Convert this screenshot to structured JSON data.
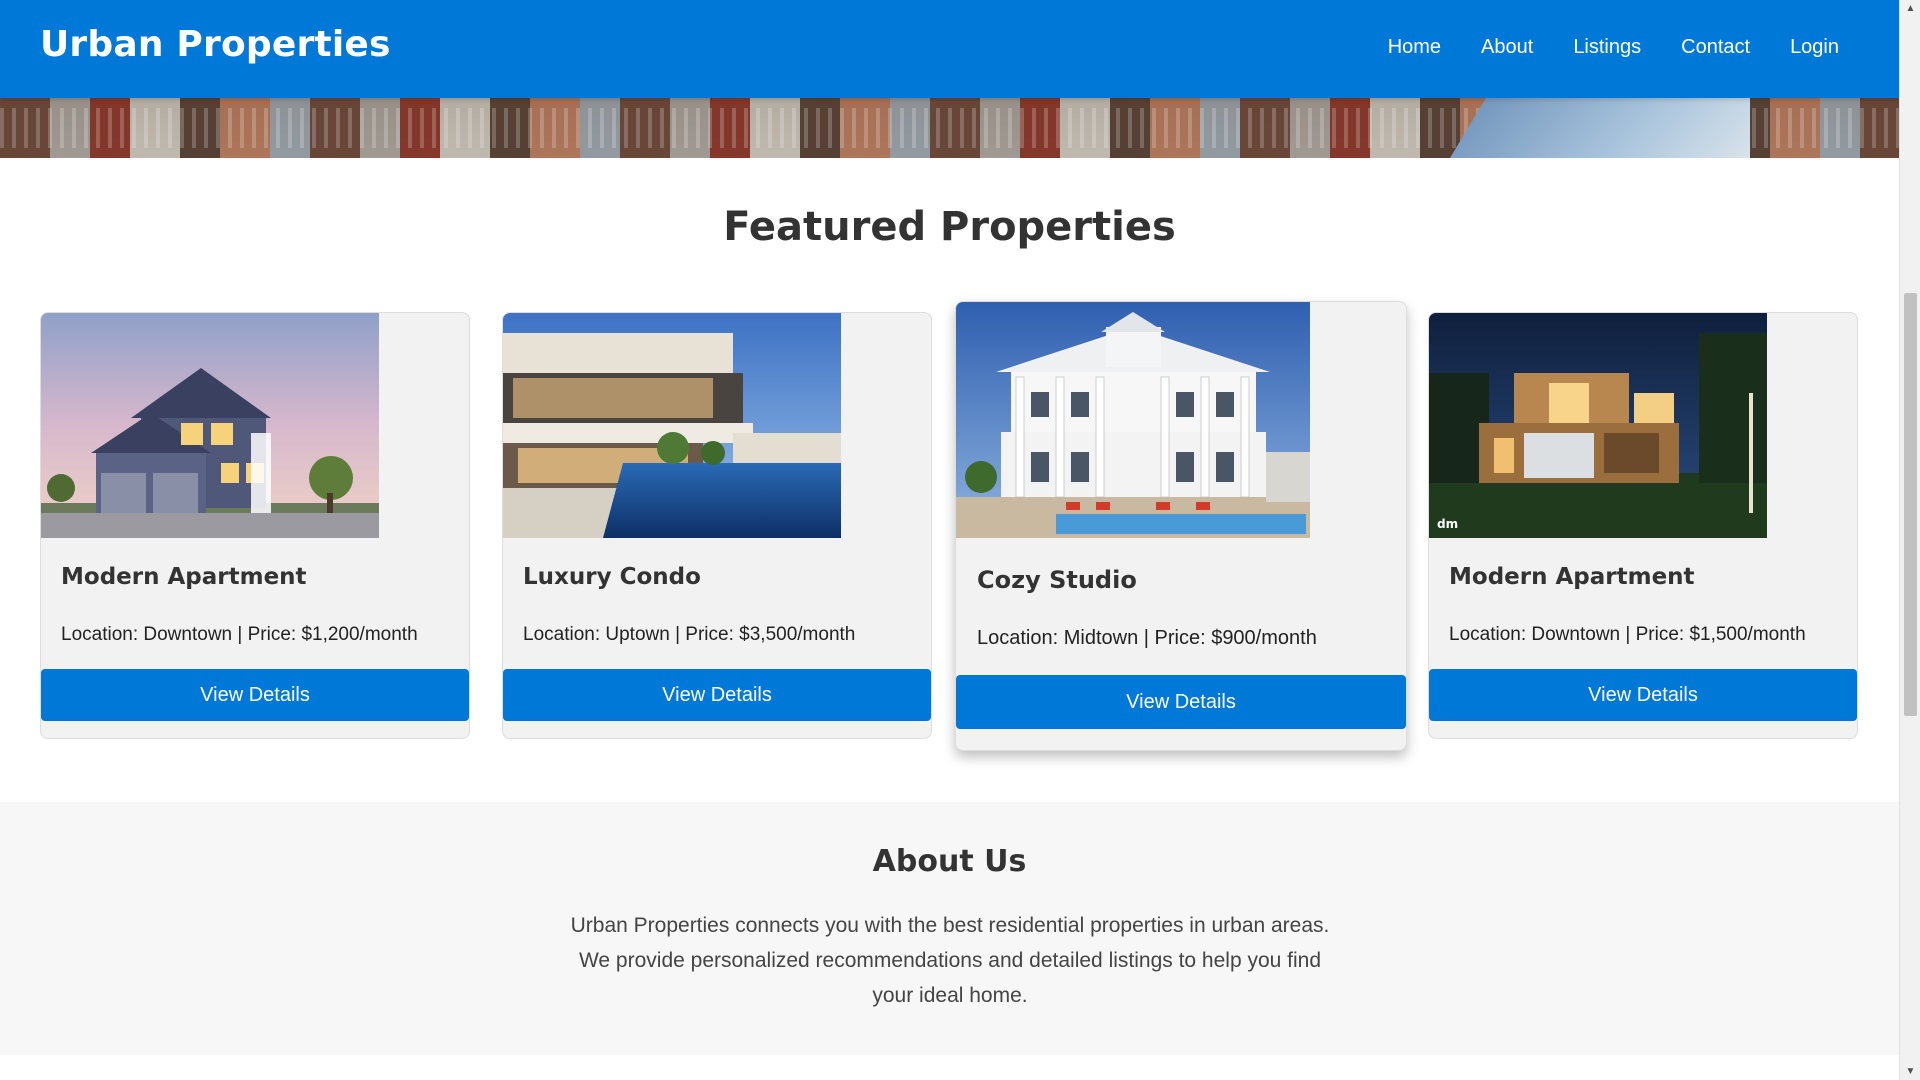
{
  "header": {
    "brand": "Urban Properties",
    "nav": [
      "Home",
      "About",
      "Listings",
      "Contact",
      "Login"
    ],
    "color": "#0078d7"
  },
  "featured": {
    "title": "Featured Properties",
    "cards": [
      {
        "title": "Modern Apartment",
        "meta": "Location: Downtown | Price: $1,200/month",
        "button": "View Details",
        "image": "suburban-house-photo"
      },
      {
        "title": "Luxury Condo",
        "meta": "Location: Uptown | Price: $3,500/month",
        "button": "View Details",
        "image": "modern-villa-pool-photo"
      },
      {
        "title": "Cozy Studio",
        "meta": "Location: Midtown | Price: $900/month",
        "button": "View Details",
        "image": "colonial-house-pool-photo"
      },
      {
        "title": "Modern Apartment",
        "meta": "Location: Downtown | Price: $1,500/month",
        "button": "View Details",
        "image": "modern-house-night-photo"
      }
    ]
  },
  "about": {
    "title": "About Us",
    "text": "Urban Properties connects you with the best residential properties in urban areas. We provide personalized recommendations and detailed listings to help you find your ideal home."
  }
}
